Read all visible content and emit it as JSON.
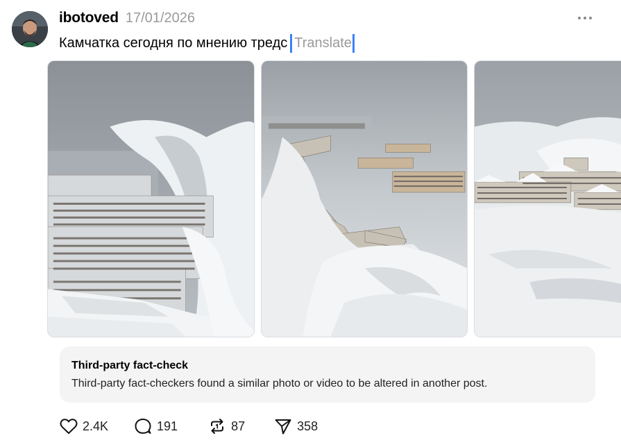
{
  "post": {
    "username": "ibotoved",
    "date": "17/01/2026",
    "caption": "Камчатка сегодня по мнению тредс",
    "translate_label": "Translate",
    "media": [
      {
        "icon": "snowy-city-photo-1"
      },
      {
        "icon": "snowy-city-photo-2"
      },
      {
        "icon": "snowy-city-photo-3"
      }
    ],
    "fact_check": {
      "title": "Third-party fact-check",
      "text": "Third-party fact-checkers found a similar photo or video to be altered in another post."
    },
    "actions": {
      "likes": "2.4K",
      "replies": "191",
      "reposts": "87",
      "shares": "358"
    }
  },
  "colors": {
    "text": "#000000",
    "muted": "#9a9a9a",
    "cursor": "#3a82f7",
    "factcheck_bg": "#f4f4f4"
  }
}
